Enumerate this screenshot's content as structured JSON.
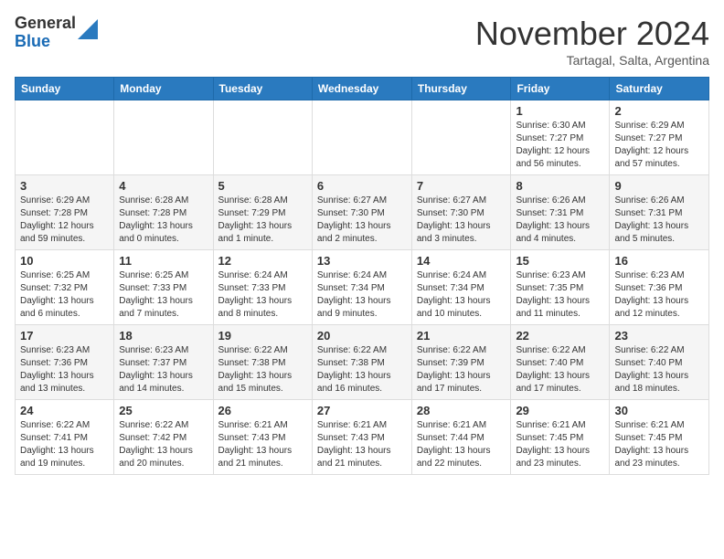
{
  "header": {
    "logo_line1": "General",
    "logo_line2": "Blue",
    "month": "November 2024",
    "location": "Tartagal, Salta, Argentina"
  },
  "weekdays": [
    "Sunday",
    "Monday",
    "Tuesday",
    "Wednesday",
    "Thursday",
    "Friday",
    "Saturday"
  ],
  "weeks": [
    [
      {
        "day": "",
        "content": ""
      },
      {
        "day": "",
        "content": ""
      },
      {
        "day": "",
        "content": ""
      },
      {
        "day": "",
        "content": ""
      },
      {
        "day": "",
        "content": ""
      },
      {
        "day": "1",
        "content": "Sunrise: 6:30 AM\nSunset: 7:27 PM\nDaylight: 12 hours and 56 minutes."
      },
      {
        "day": "2",
        "content": "Sunrise: 6:29 AM\nSunset: 7:27 PM\nDaylight: 12 hours and 57 minutes."
      }
    ],
    [
      {
        "day": "3",
        "content": "Sunrise: 6:29 AM\nSunset: 7:28 PM\nDaylight: 12 hours and 59 minutes."
      },
      {
        "day": "4",
        "content": "Sunrise: 6:28 AM\nSunset: 7:28 PM\nDaylight: 13 hours and 0 minutes."
      },
      {
        "day": "5",
        "content": "Sunrise: 6:28 AM\nSunset: 7:29 PM\nDaylight: 13 hours and 1 minute."
      },
      {
        "day": "6",
        "content": "Sunrise: 6:27 AM\nSunset: 7:30 PM\nDaylight: 13 hours and 2 minutes."
      },
      {
        "day": "7",
        "content": "Sunrise: 6:27 AM\nSunset: 7:30 PM\nDaylight: 13 hours and 3 minutes."
      },
      {
        "day": "8",
        "content": "Sunrise: 6:26 AM\nSunset: 7:31 PM\nDaylight: 13 hours and 4 minutes."
      },
      {
        "day": "9",
        "content": "Sunrise: 6:26 AM\nSunset: 7:31 PM\nDaylight: 13 hours and 5 minutes."
      }
    ],
    [
      {
        "day": "10",
        "content": "Sunrise: 6:25 AM\nSunset: 7:32 PM\nDaylight: 13 hours and 6 minutes."
      },
      {
        "day": "11",
        "content": "Sunrise: 6:25 AM\nSunset: 7:33 PM\nDaylight: 13 hours and 7 minutes."
      },
      {
        "day": "12",
        "content": "Sunrise: 6:24 AM\nSunset: 7:33 PM\nDaylight: 13 hours and 8 minutes."
      },
      {
        "day": "13",
        "content": "Sunrise: 6:24 AM\nSunset: 7:34 PM\nDaylight: 13 hours and 9 minutes."
      },
      {
        "day": "14",
        "content": "Sunrise: 6:24 AM\nSunset: 7:34 PM\nDaylight: 13 hours and 10 minutes."
      },
      {
        "day": "15",
        "content": "Sunrise: 6:23 AM\nSunset: 7:35 PM\nDaylight: 13 hours and 11 minutes."
      },
      {
        "day": "16",
        "content": "Sunrise: 6:23 AM\nSunset: 7:36 PM\nDaylight: 13 hours and 12 minutes."
      }
    ],
    [
      {
        "day": "17",
        "content": "Sunrise: 6:23 AM\nSunset: 7:36 PM\nDaylight: 13 hours and 13 minutes."
      },
      {
        "day": "18",
        "content": "Sunrise: 6:23 AM\nSunset: 7:37 PM\nDaylight: 13 hours and 14 minutes."
      },
      {
        "day": "19",
        "content": "Sunrise: 6:22 AM\nSunset: 7:38 PM\nDaylight: 13 hours and 15 minutes."
      },
      {
        "day": "20",
        "content": "Sunrise: 6:22 AM\nSunset: 7:38 PM\nDaylight: 13 hours and 16 minutes."
      },
      {
        "day": "21",
        "content": "Sunrise: 6:22 AM\nSunset: 7:39 PM\nDaylight: 13 hours and 17 minutes."
      },
      {
        "day": "22",
        "content": "Sunrise: 6:22 AM\nSunset: 7:40 PM\nDaylight: 13 hours and 17 minutes."
      },
      {
        "day": "23",
        "content": "Sunrise: 6:22 AM\nSunset: 7:40 PM\nDaylight: 13 hours and 18 minutes."
      }
    ],
    [
      {
        "day": "24",
        "content": "Sunrise: 6:22 AM\nSunset: 7:41 PM\nDaylight: 13 hours and 19 minutes."
      },
      {
        "day": "25",
        "content": "Sunrise: 6:22 AM\nSunset: 7:42 PM\nDaylight: 13 hours and 20 minutes."
      },
      {
        "day": "26",
        "content": "Sunrise: 6:21 AM\nSunset: 7:43 PM\nDaylight: 13 hours and 21 minutes."
      },
      {
        "day": "27",
        "content": "Sunrise: 6:21 AM\nSunset: 7:43 PM\nDaylight: 13 hours and 21 minutes."
      },
      {
        "day": "28",
        "content": "Sunrise: 6:21 AM\nSunset: 7:44 PM\nDaylight: 13 hours and 22 minutes."
      },
      {
        "day": "29",
        "content": "Sunrise: 6:21 AM\nSunset: 7:45 PM\nDaylight: 13 hours and 23 minutes."
      },
      {
        "day": "30",
        "content": "Sunrise: 6:21 AM\nSunset: 7:45 PM\nDaylight: 13 hours and 23 minutes."
      }
    ]
  ]
}
